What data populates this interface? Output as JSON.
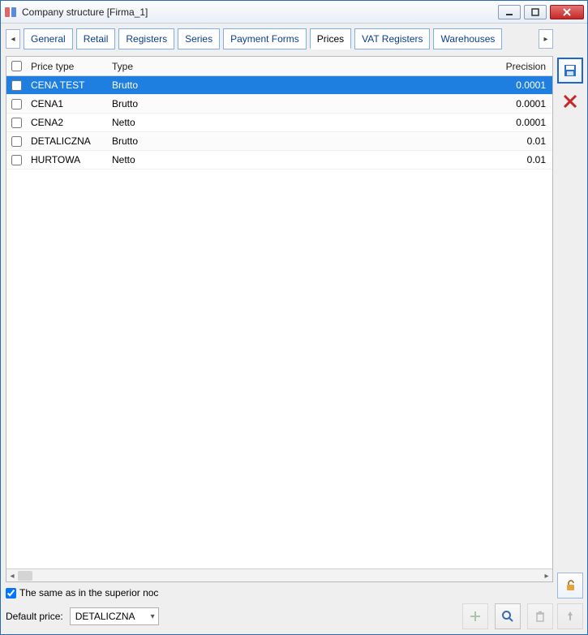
{
  "window": {
    "title": "Company structure [Firma_1]"
  },
  "tabs": {
    "items": [
      {
        "label": "General"
      },
      {
        "label": "Retail"
      },
      {
        "label": "Registers"
      },
      {
        "label": "Series"
      },
      {
        "label": "Payment Forms"
      },
      {
        "label": "Prices"
      },
      {
        "label": "VAT Registers"
      },
      {
        "label": "Warehouses"
      }
    ],
    "active_index": 5
  },
  "grid": {
    "columns": {
      "price_type": "Price type",
      "type": "Type",
      "precision": "Precision"
    },
    "rows": [
      {
        "price_type": "CENA TEST",
        "type": "Brutto",
        "precision": "0.0001",
        "selected": true
      },
      {
        "price_type": "CENA1",
        "type": "Brutto",
        "precision": "0.0001",
        "selected": false
      },
      {
        "price_type": "CENA2",
        "type": "Netto",
        "precision": "0.0001",
        "selected": false
      },
      {
        "price_type": "DETALICZNA",
        "type": "Brutto",
        "precision": "0.01",
        "selected": false
      },
      {
        "price_type": "HURTOWA",
        "type": "Netto",
        "precision": "0.01",
        "selected": false
      }
    ]
  },
  "footer": {
    "same_as_superior_label": "The same as in the superior noc",
    "same_as_superior_checked": true,
    "default_price_label": "Default price:",
    "default_price_value": "DETALICZNA"
  },
  "icons": {
    "app": "app-icon",
    "minimize": "minimize-icon",
    "maximize": "maximize-icon",
    "close": "close-icon",
    "save": "floppy-icon",
    "delete_x": "red-x-icon",
    "unlock": "unlock-icon",
    "pin": "pin-icon",
    "add": "plus-icon",
    "search": "magnifier-icon",
    "trash": "trash-icon",
    "scroll_left": "triangle-left-icon",
    "scroll_right": "triangle-right-icon",
    "dropdown": "chevron-down-icon"
  }
}
